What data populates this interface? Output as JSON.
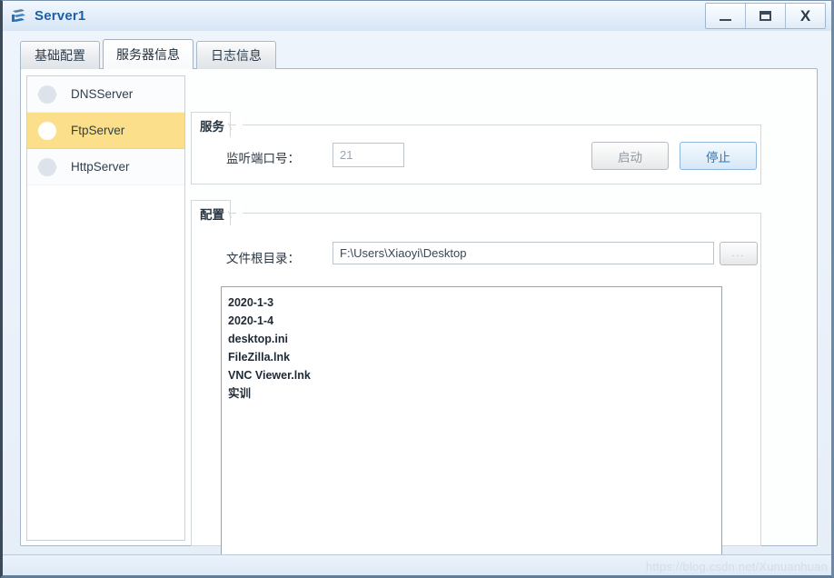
{
  "window": {
    "title": "Server1",
    "icon": "server-app-icon",
    "controls": {
      "minimize": "—",
      "maximize": "□",
      "close": "X"
    }
  },
  "tabs": [
    {
      "label": "基础配置",
      "active": false
    },
    {
      "label": "服务器信息",
      "active": true
    },
    {
      "label": "日志信息",
      "active": false
    }
  ],
  "sidebar": {
    "items": [
      {
        "label": "DNSServer",
        "selected": false,
        "status_icon": "status-dot-idle"
      },
      {
        "label": "FtpServer",
        "selected": true,
        "status_icon": "status-dot-active"
      },
      {
        "label": "HttpServer",
        "selected": false,
        "status_icon": "status-dot-idle"
      }
    ]
  },
  "service_group": {
    "title": "服务",
    "port_label": "监听端口号：",
    "port_value": "21",
    "port_placeholder": "",
    "start_button": "启动",
    "stop_button": "停止"
  },
  "config_group": {
    "title": "配置",
    "root_label": "文件根目录：",
    "root_value": "F:\\Users\\Xiaoyi\\Desktop",
    "root_placeholder": "",
    "browse_button": "...",
    "files": [
      "2020-1-3",
      "2020-1-4",
      "desktop.ini",
      "FileZilla.lnk",
      "VNC Viewer.lnk",
      "实训"
    ]
  },
  "statusbar": {
    "watermark": "https://blog.csdn.net/Xunuanhuan"
  },
  "colors": {
    "title_text": "#1a5fa8",
    "selection_highlight": "#fbdf8a",
    "primary_button_text": "#2a7ac4",
    "disabled_text": "#909aa3"
  }
}
